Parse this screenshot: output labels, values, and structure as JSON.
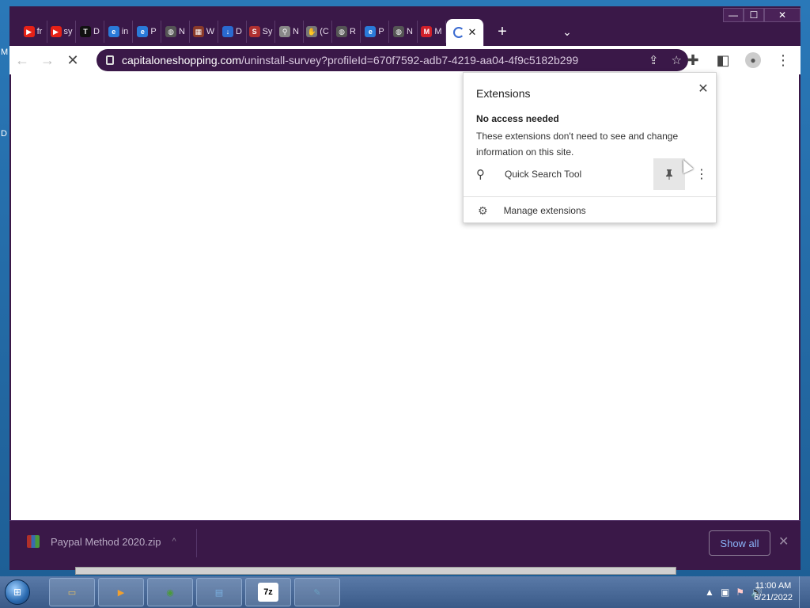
{
  "desktop": {
    "left_letters": [
      "M",
      "D"
    ]
  },
  "window": {
    "controls": {
      "minimize": "—",
      "maximize": "☐",
      "close": "✕"
    },
    "tabs": [
      {
        "icon": "youtube-icon",
        "icon_glyph": "▶",
        "color": "#e62117",
        "label": "fr"
      },
      {
        "icon": "youtube-icon",
        "icon_glyph": "▶",
        "color": "#e62117",
        "label": "sy"
      },
      {
        "icon": "text-icon",
        "icon_glyph": "T",
        "color": "#111111",
        "label": "D"
      },
      {
        "icon": "edge-icon",
        "icon_glyph": "e",
        "color": "#2a7ad8",
        "label": "in"
      },
      {
        "icon": "edge-icon",
        "icon_glyph": "e",
        "color": "#2a7ad8",
        "label": "P"
      },
      {
        "icon": "globe-icon",
        "icon_glyph": "◍",
        "color": "#555555",
        "label": "N"
      },
      {
        "icon": "winrar-icon",
        "icon_glyph": "▦",
        "color": "#8a3a2a",
        "label": "W"
      },
      {
        "icon": "download-icon",
        "icon_glyph": "↓",
        "color": "#2a6ad0",
        "label": "D"
      },
      {
        "icon": "s-icon",
        "icon_glyph": "S",
        "color": "#b03030",
        "label": "Sy"
      },
      {
        "icon": "search-icon",
        "icon_glyph": "⚲",
        "color": "#888888",
        "label": "N"
      },
      {
        "icon": "hand-icon",
        "icon_glyph": "✋",
        "color": "#777777",
        "label": "(C"
      },
      {
        "icon": "globe-icon",
        "icon_glyph": "◍",
        "color": "#555555",
        "label": "R"
      },
      {
        "icon": "edge-icon",
        "icon_glyph": "e",
        "color": "#2a7ad8",
        "label": "P"
      },
      {
        "icon": "globe-icon",
        "icon_glyph": "◍",
        "color": "#555555",
        "label": "N"
      },
      {
        "icon": "m-icon",
        "icon_glyph": "M",
        "color": "#d0202a",
        "label": "M"
      }
    ],
    "active_tab": {
      "icon": "loading-spinner-icon",
      "close": "✕"
    },
    "new_tab": "+",
    "tab_menu": "⌄",
    "toolbar": {
      "back": "←",
      "forward": "→",
      "stop": "✕",
      "url_domain": "capitaloneshopping.com",
      "url_path": "/uninstall-survey?profileId=670f7592-adb7-4219-aa04-4f9c5182b299",
      "share": "⇪",
      "star": "☆",
      "extensions": "✚",
      "sidepanel": "◧",
      "profile": "●",
      "menu": "⋮"
    }
  },
  "extensions_popup": {
    "title": "Extensions",
    "close": "✕",
    "subheading": "No access needed",
    "description": "These extensions don't need to see and change information on this site.",
    "items": [
      {
        "icon": "search-icon",
        "glyph": "⚲",
        "name": "Quick Search Tool",
        "pin": "📌",
        "more": "⋮"
      }
    ],
    "manage": {
      "icon": "gear-icon",
      "glyph": "⚙",
      "label": "Manage extensions"
    }
  },
  "download_bar": {
    "file_name": "Paypal Method 2020.zip",
    "caret": "^",
    "show_all": "Show all",
    "close": "✕"
  },
  "taskbar": {
    "start": "⊞",
    "apps": [
      {
        "name": "explorer-icon",
        "glyph": "▭",
        "color": "#e8c060"
      },
      {
        "name": "media-player-icon",
        "glyph": "▶",
        "color": "#f0a030"
      },
      {
        "name": "chrome-icon",
        "glyph": "◉",
        "color": "#4a9a3a"
      },
      {
        "name": "control-panel-icon",
        "glyph": "▤",
        "color": "#7ab0e0"
      },
      {
        "name": "7zip-icon",
        "glyph": "7z",
        "color": "#000000"
      },
      {
        "name": "notepad-icon",
        "glyph": "✎",
        "color": "#6aa0c0"
      }
    ],
    "tray": {
      "expand": "▲",
      "network": "▣",
      "flag": "⚑",
      "volume": "🔊"
    },
    "time": "11:00 AM",
    "date": "6/21/2022"
  }
}
